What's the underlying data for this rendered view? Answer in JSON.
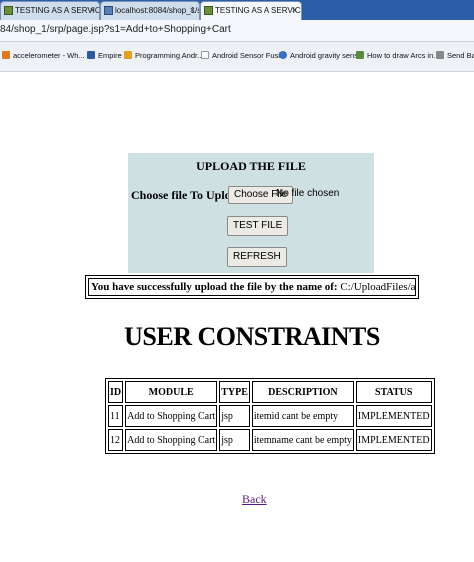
{
  "browser": {
    "tabs": [
      {
        "title": "TESTING AS A SERVICE",
        "close": "×"
      },
      {
        "title": "localhost:8084/shop_1/srp",
        "close": "×"
      },
      {
        "title": "TESTING AS A SERVICE",
        "close": "×"
      }
    ],
    "url": "84/shop_1/srp/page.jsp?s1=Add+to+Shopping+Cart",
    "bookmarks": [
      "accelerometer - Wh...",
      "Empire",
      "Programming Andr...",
      "Android Sensor Fusi...",
      "Android gravity sens...",
      "How to draw Arcs in...",
      "Send Base"
    ]
  },
  "upload": {
    "title": "UPLOAD THE FILE",
    "choose_label": "Choose file To Upload:",
    "choose_button": "Choose File",
    "no_file": "No file chosen",
    "test_button": "TEST FILE",
    "refresh_button": "REFRESH"
  },
  "message": {
    "prefix": "You have successfully upload the file by the name of:",
    "filename": "C:/UploadFiles/add to cart.jsp"
  },
  "constraints": {
    "title": "USER CONSTRAINTS",
    "headers": [
      "ID",
      "MODULE",
      "TYPE",
      "DESCRIPTION",
      "STATUS"
    ],
    "rows": [
      [
        "11",
        "Add to Shopping Cart",
        "jsp",
        "itemid cant be empty",
        "IMPLEMENTED"
      ],
      [
        "12",
        "Add to Shopping Cart",
        "jsp",
        "itemname cant be empty",
        "IMPLEMENTED"
      ]
    ]
  },
  "back_link": "Back"
}
